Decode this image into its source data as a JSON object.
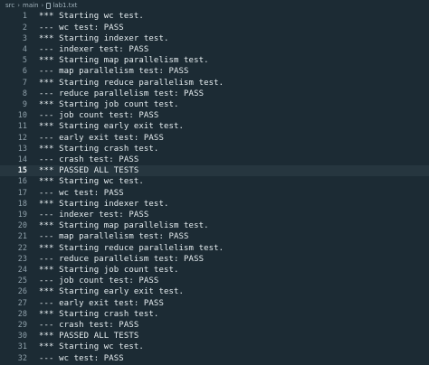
{
  "breadcrumb": [
    "src",
    "main",
    "lab1.txt"
  ],
  "editor": {
    "active_line": 15,
    "lines": [
      {
        "n": "1",
        "text": "*** Starting wc test."
      },
      {
        "n": "2",
        "text": "--- wc test: PASS"
      },
      {
        "n": "3",
        "text": "*** Starting indexer test."
      },
      {
        "n": "4",
        "text": "--- indexer test: PASS"
      },
      {
        "n": "5",
        "text": "*** Starting map parallelism test."
      },
      {
        "n": "6",
        "text": "--- map parallelism test: PASS"
      },
      {
        "n": "7",
        "text": "*** Starting reduce parallelism test."
      },
      {
        "n": "8",
        "text": "--- reduce parallelism test: PASS"
      },
      {
        "n": "9",
        "text": "*** Starting job count test."
      },
      {
        "n": "10",
        "text": "--- job count test: PASS"
      },
      {
        "n": "11",
        "text": "*** Starting early exit test."
      },
      {
        "n": "12",
        "text": "--- early exit test: PASS"
      },
      {
        "n": "13",
        "text": "*** Starting crash test."
      },
      {
        "n": "14",
        "text": "--- crash test: PASS"
      },
      {
        "n": "15",
        "text": "*** PASSED ALL TESTS"
      },
      {
        "n": "16",
        "text": "*** Starting wc test."
      },
      {
        "n": "17",
        "text": "--- wc test: PASS"
      },
      {
        "n": "18",
        "text": "*** Starting indexer test."
      },
      {
        "n": "19",
        "text": "--- indexer test: PASS"
      },
      {
        "n": "20",
        "text": "*** Starting map parallelism test."
      },
      {
        "n": "21",
        "text": "--- map parallelism test: PASS"
      },
      {
        "n": "22",
        "text": "*** Starting reduce parallelism test."
      },
      {
        "n": "23",
        "text": "--- reduce parallelism test: PASS"
      },
      {
        "n": "24",
        "text": "*** Starting job count test."
      },
      {
        "n": "25",
        "text": "--- job count test: PASS"
      },
      {
        "n": "26",
        "text": "*** Starting early exit test."
      },
      {
        "n": "27",
        "text": "--- early exit test: PASS"
      },
      {
        "n": "28",
        "text": "*** Starting crash test."
      },
      {
        "n": "29",
        "text": "--- crash test: PASS"
      },
      {
        "n": "30",
        "text": "*** PASSED ALL TESTS"
      },
      {
        "n": "31",
        "text": "*** Starting wc test."
      },
      {
        "n": "32",
        "text": "--- wc test: PASS"
      }
    ]
  }
}
